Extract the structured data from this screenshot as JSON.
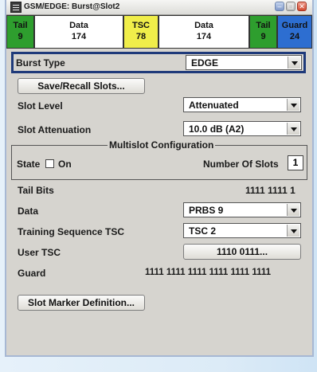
{
  "window": {
    "title": "GSM/EDGE: Burst@Slot2"
  },
  "burst_segments": [
    {
      "label": "Tail",
      "value": "9",
      "color": "#2e9e2e"
    },
    {
      "label": "Data",
      "value": "174",
      "color": "#ffffff"
    },
    {
      "label": "TSC",
      "value": "78",
      "color": "#f0ee4a"
    },
    {
      "label": "Data",
      "value": "174",
      "color": "#ffffff"
    },
    {
      "label": "Tail",
      "value": "9",
      "color": "#2e9e2e"
    },
    {
      "label": "Guard",
      "value": "24",
      "color": "#2d6ed1"
    }
  ],
  "burst_type": {
    "label": "Burst Type",
    "value": "EDGE"
  },
  "save_recall": {
    "label": "Save/Recall Slots..."
  },
  "slot_level": {
    "label": "Slot Level",
    "value": "Attenuated"
  },
  "slot_attenuation": {
    "label": "Slot Attenuation",
    "value": "10.0 dB  (A2)"
  },
  "multislot": {
    "title": "Multislot Configuration",
    "state_label": "State",
    "on_label": "On",
    "num_slots_label": "Number Of Slots",
    "num_slots_value": "1"
  },
  "tail_bits": {
    "label": "Tail Bits",
    "value": "1111 1111 1"
  },
  "data": {
    "label": "Data",
    "value": "PRBS  9"
  },
  "training_sequence": {
    "label": "Training Sequence TSC",
    "value": "TSC 2"
  },
  "user_tsc": {
    "label": "User TSC",
    "value": "1110 0111..."
  },
  "guard": {
    "label": "Guard",
    "value": "1111 1111 1111 1111 1111 1111"
  },
  "slot_marker": {
    "label": "Slot Marker Definition..."
  },
  "colors": {
    "focus_border": "#1f3a7a",
    "panel": "#d6d4cf"
  }
}
